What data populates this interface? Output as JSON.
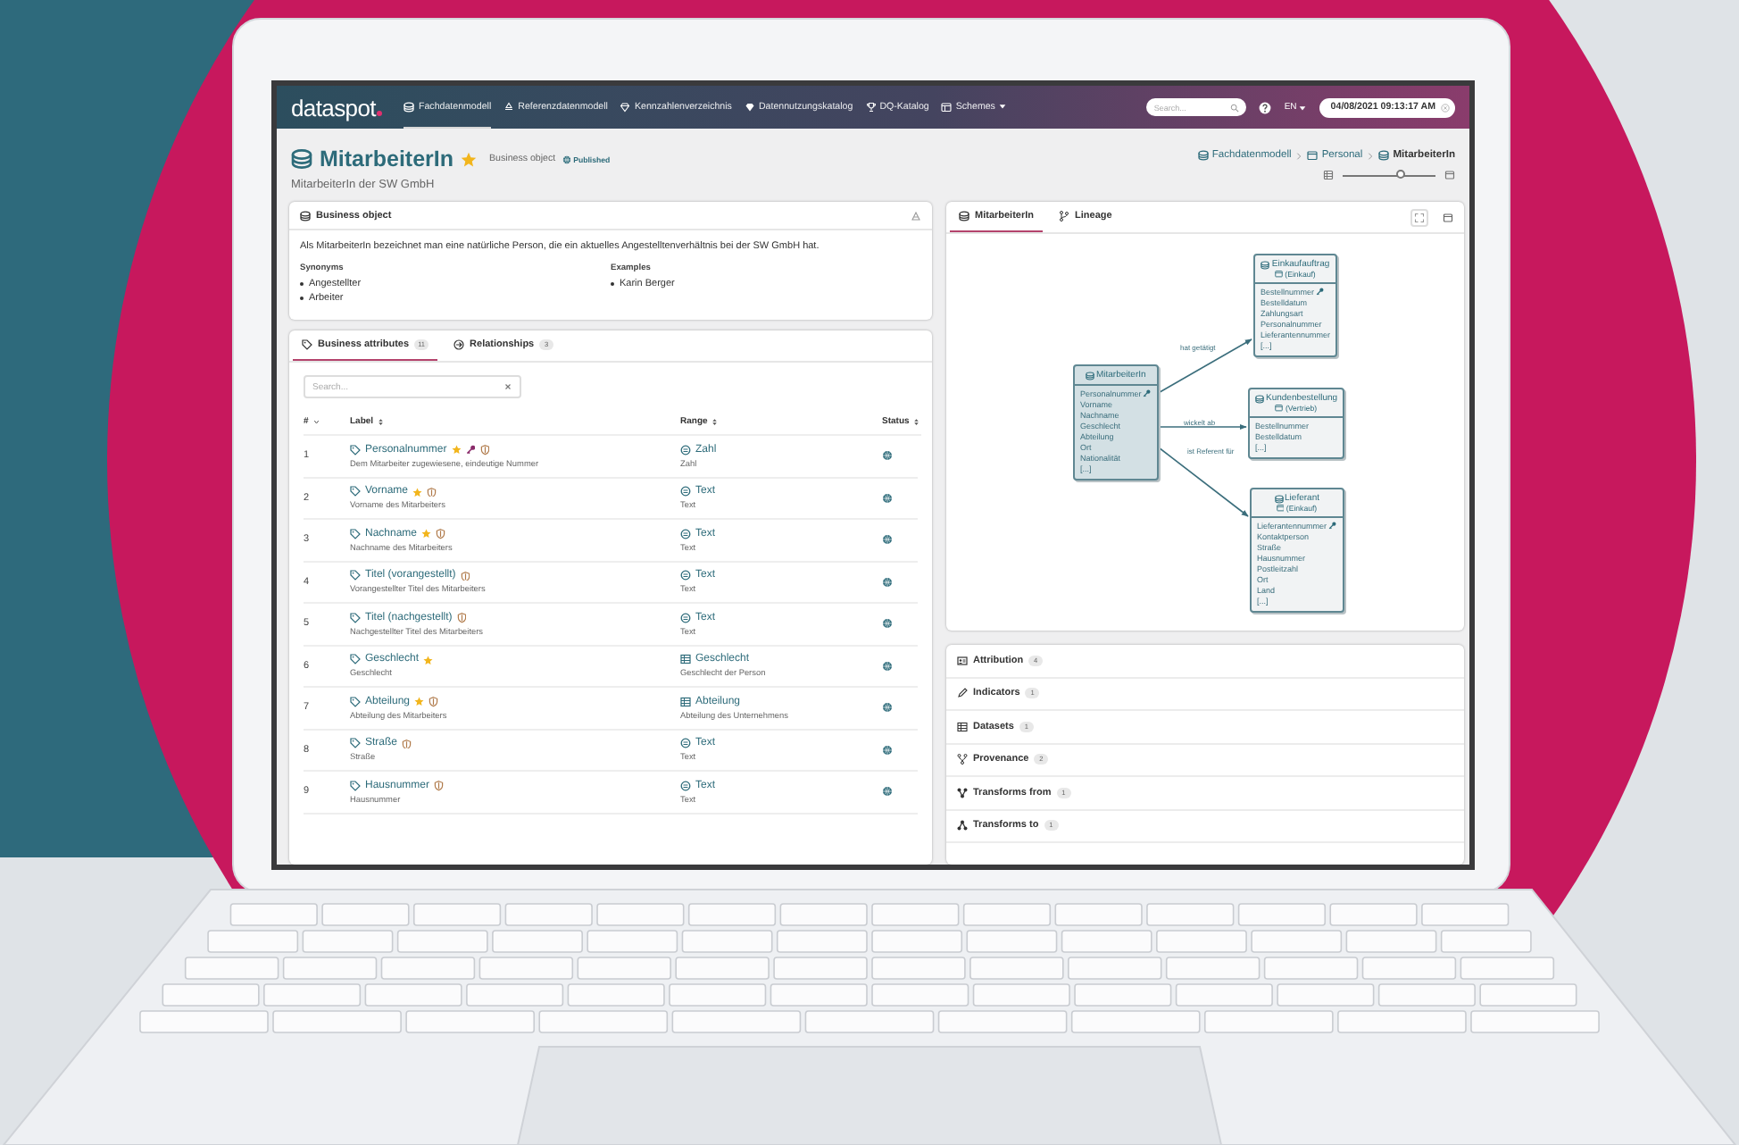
{
  "navbar": {
    "logo": "dataspot",
    "items": [
      {
        "label": "Fachdatenmodell",
        "selected": true,
        "dropdown": false
      },
      {
        "label": "Referenzdatenmodell",
        "selected": false,
        "dropdown": false
      },
      {
        "label": "Kennzahlenverzeichnis",
        "selected": false,
        "dropdown": false
      },
      {
        "label": "Datennutzungskatalog",
        "selected": false,
        "dropdown": false
      },
      {
        "label": "DQ-Katalog",
        "selected": false,
        "dropdown": false
      },
      {
        "label": "Schemes",
        "selected": false,
        "dropdown": true
      }
    ],
    "search": {
      "placeholder": "Search..."
    },
    "language": "EN",
    "datetime": "04/08/2021 09:13:17 AM"
  },
  "header": {
    "title": "MitarbeiterIn",
    "starred": true,
    "type": "Business object",
    "status": "Published",
    "subtitle": "MitarbeiterIn der SW GmbH",
    "breadcrumb": [
      "Fachdatenmodell",
      "Personal",
      "MitarbeiterIn"
    ],
    "zoom": {
      "level": 0.62
    }
  },
  "business_object": {
    "title": "Business object",
    "description": "Als MitarbeiterIn bezeichnet man eine natürliche Person, die ein aktuelles Angestelltenverhältnis bei der SW GmbH hat.",
    "synonyms": {
      "label": "Synonyms",
      "items": [
        "Angestellter",
        "Arbeiter"
      ]
    },
    "examples": {
      "label": "Examples",
      "items": [
        "Karin Berger"
      ]
    }
  },
  "attributes": {
    "tabs": [
      {
        "label": "Business attributes",
        "count": "11",
        "selected": true
      },
      {
        "label": "Relationships",
        "count": "3",
        "selected": false
      }
    ],
    "search": {
      "placeholder": "Search..."
    },
    "columns": [
      "#",
      "Label",
      "Range",
      "Status"
    ],
    "rows": [
      {
        "number": "1",
        "label": "Personalnummer",
        "starred": true,
        "key": true,
        "shield": true,
        "description": "Dem Mitarbeiter zugewiesene, eindeutige Nummer",
        "kind": "type",
        "range": "Zahl",
        "range_description": "Zahl"
      },
      {
        "number": "2",
        "label": "Vorname",
        "starred": true,
        "key": false,
        "shield": true,
        "description": "Vorname des Mitarbeiters",
        "kind": "type",
        "range": "Text",
        "range_description": "Text"
      },
      {
        "number": "3",
        "label": "Nachname",
        "starred": true,
        "key": false,
        "shield": true,
        "description": "Nachname des Mitarbeiters",
        "kind": "type",
        "range": "Text",
        "range_description": "Text"
      },
      {
        "number": "4",
        "label": "Titel (vorangestellt)",
        "starred": false,
        "key": false,
        "shield": true,
        "description": "Vorangestellter Titel des Mitarbeiters",
        "kind": "type",
        "range": "Text",
        "range_description": "Text"
      },
      {
        "number": "5",
        "label": "Titel (nachgestellt)",
        "starred": false,
        "key": false,
        "shield": true,
        "description": "Nachgestellter Titel des Mitarbeiters",
        "kind": "type",
        "range": "Text",
        "range_description": "Text"
      },
      {
        "number": "6",
        "label": "Geschlecht",
        "starred": true,
        "key": false,
        "shield": false,
        "description": "Geschlecht",
        "kind": "enum",
        "range": "Geschlecht",
        "range_description": "Geschlecht der Person"
      },
      {
        "number": "7",
        "label": "Abteilung",
        "starred": true,
        "key": false,
        "shield": true,
        "description": "Abteilung des Mitarbeiters",
        "kind": "enum",
        "range": "Abteilung",
        "range_description": "Abteilung des Unternehmens"
      },
      {
        "number": "8",
        "label": "Straße",
        "starred": false,
        "key": false,
        "shield": true,
        "description": "Straße",
        "kind": "type",
        "range": "Text",
        "range_description": "Text"
      },
      {
        "number": "9",
        "label": "Hausnummer",
        "starred": false,
        "key": false,
        "shield": true,
        "description": "Hausnummer",
        "kind": "type",
        "range": "Text",
        "range_description": "Text"
      }
    ]
  },
  "diagram": {
    "tabs": [
      {
        "label": "MitarbeiterIn",
        "selected": true
      },
      {
        "label": "Lineage",
        "selected": false
      }
    ],
    "nodes": [
      {
        "title": "MitarbeiterIn",
        "selected": true,
        "attributes": [
          {
            "name": "Personalnummer",
            "key": true
          },
          {
            "name": "Vorname",
            "key": false
          },
          {
            "name": "Nachname",
            "key": false
          },
          {
            "name": "Geschlecht",
            "key": false
          },
          {
            "name": "Abteilung",
            "key": false
          },
          {
            "name": "Ort",
            "key": false
          },
          {
            "name": "Nationalität",
            "key": false
          },
          {
            "name": "[...]",
            "key": false
          }
        ]
      },
      {
        "title": "Einkaufauftrag",
        "scope": "(Einkauf)",
        "selected": false,
        "attributes": [
          {
            "name": "Bestellnummer",
            "key": true
          },
          {
            "name": "Bestelldatum",
            "key": false
          },
          {
            "name": "Zahlungsart",
            "key": false
          },
          {
            "name": "Personalnummer",
            "key": false
          },
          {
            "name": "Lieferantennummer",
            "key": false
          },
          {
            "name": "[...]",
            "key": false
          }
        ]
      },
      {
        "title": "Kundenbestellung",
        "scope": "(Vertrieb)",
        "selected": false,
        "attributes": [
          {
            "name": "Bestellnummer",
            "key": false
          },
          {
            "name": "Bestelldatum",
            "key": false
          },
          {
            "name": "[...]",
            "key": false
          }
        ]
      },
      {
        "title": "Lieferant",
        "scope": "(Einkauf)",
        "selected": false,
        "attributes": [
          {
            "name": "Lieferantennummer",
            "key": true
          },
          {
            "name": "Kontaktperson",
            "key": false
          },
          {
            "name": "Straße",
            "key": false
          },
          {
            "name": "Hausnummer",
            "key": false
          },
          {
            "name": "Postleitzahl",
            "key": false
          },
          {
            "name": "Ort",
            "key": false
          },
          {
            "name": "Land",
            "key": false
          },
          {
            "name": "[...]",
            "key": false
          }
        ]
      }
    ],
    "edges": [
      {
        "label": "hat getätigt"
      },
      {
        "label": "wickelt ab"
      },
      {
        "label": "ist Referent für"
      }
    ]
  },
  "sections": [
    {
      "label": "Attribution",
      "count": "4"
    },
    {
      "label": "Indicators",
      "count": "1"
    },
    {
      "label": "Datasets",
      "count": "1"
    },
    {
      "label": "Provenance",
      "count": "2"
    },
    {
      "label": "Transforms from",
      "count": "1"
    },
    {
      "label": "Transforms to",
      "count": "1"
    }
  ]
}
